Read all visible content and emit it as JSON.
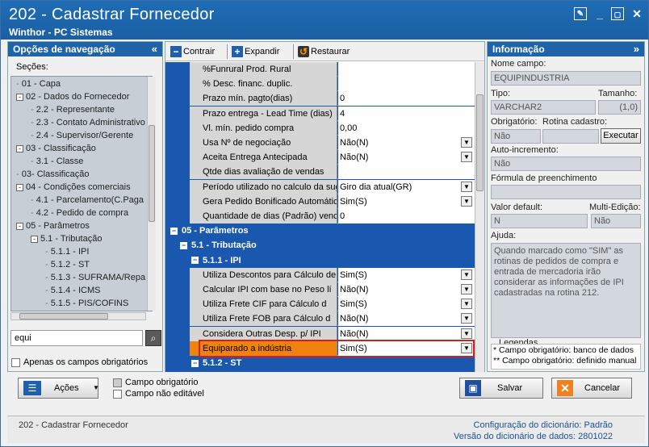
{
  "window": {
    "title": "202 - Cadastrar  Fornecedor",
    "subtitle": "Winthor - PC Sistemas"
  },
  "left": {
    "header": "Opções de navegação",
    "sections_label": "Seções:",
    "tree": [
      {
        "label": "01 - Capa",
        "indent": 0,
        "exp": ""
      },
      {
        "label": "02 - Dados do Fornecedor",
        "indent": 0,
        "exp": "-"
      },
      {
        "label": "2.2 - Representante",
        "indent": 1,
        "exp": ""
      },
      {
        "label": "2.3 - Contato Administrativo",
        "indent": 1,
        "exp": ""
      },
      {
        "label": "2.4 - Supervisor/Gerente",
        "indent": 1,
        "exp": ""
      },
      {
        "label": "03 - Classificação",
        "indent": 0,
        "exp": "-"
      },
      {
        "label": "3.1 - Classe",
        "indent": 1,
        "exp": ""
      },
      {
        "label": "03- Classificação",
        "indent": 0,
        "exp": ""
      },
      {
        "label": "04 - Condições comerciais",
        "indent": 0,
        "exp": "-"
      },
      {
        "label": "4.1 - Parcelamento(C.Paga",
        "indent": 1,
        "exp": ""
      },
      {
        "label": "4.2 - Pedido de compra",
        "indent": 1,
        "exp": ""
      },
      {
        "label": "05 - Parâmetros",
        "indent": 0,
        "exp": "-"
      },
      {
        "label": "5.1 - Tributação",
        "indent": 1,
        "exp": "-"
      },
      {
        "label": "5.1.1 - IPI",
        "indent": 2,
        "exp": ""
      },
      {
        "label": "5.1.2 - ST",
        "indent": 2,
        "exp": ""
      },
      {
        "label": "5.1.3 - SUFRAMA/Repa",
        "indent": 2,
        "exp": ""
      },
      {
        "label": "5.1.4 - ICMS",
        "indent": 2,
        "exp": ""
      },
      {
        "label": "5.1.5 - PIS/COFINS",
        "indent": 2,
        "exp": ""
      }
    ],
    "search_value": "equi",
    "only_required_label": "Apenas os campos obrigatórios"
  },
  "toolbar": {
    "collapse": "Contrair",
    "expand": "Expandir",
    "restore": "Restaurar"
  },
  "grid": {
    "rows_top": [
      {
        "label": "%Funrural Prod. Rural",
        "value": "",
        "dd": false
      },
      {
        "label": "% Desc. financ. duplic.",
        "value": "",
        "dd": false
      },
      {
        "label": "Prazo mín. pagto(dias)",
        "value": "0",
        "dd": false
      },
      {
        "label": "Prazo entrega - Lead Time (dias)",
        "value": "4",
        "dd": false
      },
      {
        "label": "Vl. mín. pedido compra",
        "value": "0,00",
        "dd": false
      },
      {
        "label": "Usa Nº de negociação",
        "value": "Não(N)",
        "dd": true
      },
      {
        "label": "Aceita Entrega Antecipada",
        "value": "Não(N)",
        "dd": true
      },
      {
        "label": "Qtde dias avaliação de vendas",
        "value": "",
        "dd": false
      },
      {
        "label": "Período utilizado no calculo da suge",
        "value": "Giro dia atual(GR)",
        "dd": true
      },
      {
        "label": "Gera Pedido Bonificado Automático",
        "value": "Sim(S)",
        "dd": true
      },
      {
        "label": "Quantidade de dias (Padrão) venc",
        "value": "0",
        "dd": false
      }
    ],
    "sec05": "05 - Parâmetros",
    "sec51": "5.1 - Tributação",
    "sec511": "5.1.1 - IPI",
    "rows_ipi": [
      {
        "label": "Utiliza Descontos para Cálculo de",
        "value": "Sim(S)",
        "dd": true
      },
      {
        "label": "Calcular IPI com base no Peso lí",
        "value": "Não(N)",
        "dd": true
      },
      {
        "label": "Utiliza Frete CIF para Cálculo d",
        "value": "Sim(S)",
        "dd": true
      },
      {
        "label": "Utiliza Frete FOB para Cálculo d",
        "value": "Não(N)",
        "dd": true
      },
      {
        "label": "Considera Outras Desp. p/ IPI",
        "value": "Não(N)",
        "dd": true
      },
      {
        "label": "Equiparado a indústria",
        "value": "Sim(S)",
        "dd": true
      }
    ],
    "sec512": "5.1.2 - ST"
  },
  "info": {
    "header": "Informação",
    "field_name_label": "Nome campo:",
    "field_name": "EQUIPINDUSTRIA",
    "type_label": "Tipo:",
    "type": "VARCHAR2",
    "size_label": "Tamanho:",
    "size": "(1,0)",
    "required_label": "Obrigatório:",
    "required": "Não",
    "routine_label": "Rotina cadastro:",
    "execute": "Executar",
    "autoinc_label": "Auto-incremento:",
    "autoinc": "Não",
    "formula_label": "Fórmula de preenchimento",
    "formula": "",
    "default_label": "Valor default:",
    "default": "N",
    "multi_label": "Multi-Edição:",
    "multi": "Não",
    "help_label": "Ajuda:",
    "help": "Quando marcado como \"SIM\" as rotinas de pedidos de compra e entrada de mercadoria irão considerar as informações de IPI cadastradas na rotina 212.",
    "legend_title": "Legendas",
    "legend1": "* Campo obrigatório: banco de dados",
    "legend2": "** Campo obrigatório: definido manual"
  },
  "bottom": {
    "actions": "Ações",
    "legend_required": "Campo obrigatório",
    "legend_noedit": "Campo não editável",
    "save": "Salvar",
    "cancel": "Cancelar"
  },
  "status": {
    "left": "202 - Cadastrar  Fornecedor",
    "dict_config_label": "Configuração do dicionário:",
    "dict_config": "Padrão",
    "dict_version_label": "Versão do dicionário de dados:",
    "dict_version": "2801022"
  },
  "colors": {
    "titlebar": "#1f6db6",
    "grid_bg": "#1a58b0",
    "highlight": "#f0820f"
  }
}
